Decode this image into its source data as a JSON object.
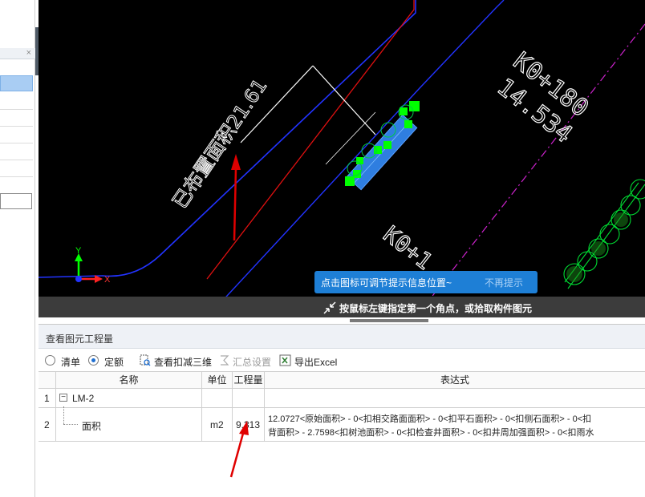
{
  "canvas": {
    "labels": {
      "station_top": "K0+180",
      "station_top_value": "14.534",
      "station_bottom": "K0+1",
      "rotated_label": "已布置面积21.61"
    },
    "axis": {
      "x_label": "X",
      "y_label": "Y"
    },
    "tip_popup": {
      "message": "点击图标可调节提示信息位置~",
      "dismiss": "不再提示"
    },
    "status_text": "按鼠标左键指定第一个角点，或拾取构件图元"
  },
  "panel": {
    "title": "查看图元工程量",
    "toolbar": {
      "radio_list_label": "清单",
      "radio_quota_label": "定额",
      "radio_selected": "定额",
      "view_3d_label": "查看扣减三维",
      "summary_label": "汇总设置",
      "export_label": "导出Excel"
    },
    "table": {
      "headers": {
        "name": "名称",
        "unit": "单位",
        "qty": "工程量",
        "expr": "表达式"
      },
      "rows": [
        {
          "num": "1",
          "name": "LM-2",
          "unit": "",
          "qty": "",
          "expr_line1": "",
          "expr_line2": ""
        },
        {
          "num": "2",
          "name": "面积",
          "unit": "m2",
          "qty": "9.313",
          "expr_line1": "12.0727<原始面积> - 0<扣相交路面面积> - 0<扣平石面积> - 0<扣侧石面积> - 0<扣",
          "expr_line2": "背面积> - 2.7598<扣树池面积> - 0<扣检查井面积> - 0<扣井周加强面积> - 0<扣雨水"
        }
      ]
    }
  },
  "colors": {
    "canvas_bg": "#000000",
    "selection_blue": "#1e7fd6",
    "grip_green": "#00ff00",
    "annotation_red": "#ff0000"
  }
}
